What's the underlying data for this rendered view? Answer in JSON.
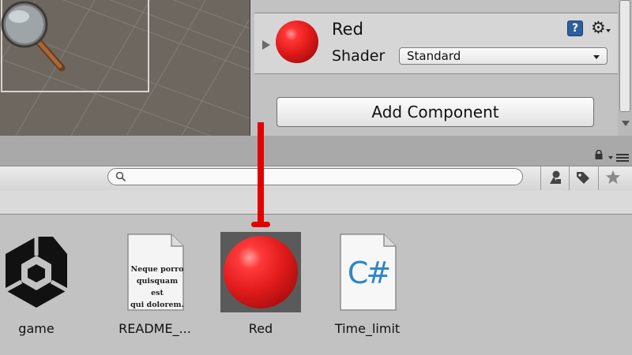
{
  "inspector": {
    "material_name": "Red",
    "shader_label": "Shader",
    "shader_value": "Standard",
    "help_icon": "?",
    "gear_icon": "⚙",
    "add_component_label": "Add Component"
  },
  "project": {
    "search_value": "",
    "assets": [
      {
        "name": "game",
        "icon": "unity-logo-icon",
        "selected": false
      },
      {
        "name": "README_...",
        "icon": "document-icon",
        "preview_text": [
          "Neque porro",
          "quisquam est",
          "qui dolorem."
        ],
        "selected": false
      },
      {
        "name": "Red",
        "icon": "material-sphere-icon",
        "selected": true
      },
      {
        "name": "Time_limit",
        "icon": "csharp-script-icon",
        "preview_text": [
          "C#"
        ],
        "selected": false
      }
    ]
  },
  "colors": {
    "annotation": "#e30000",
    "material": "#e01a1a",
    "csharp": "#2d86c8"
  }
}
